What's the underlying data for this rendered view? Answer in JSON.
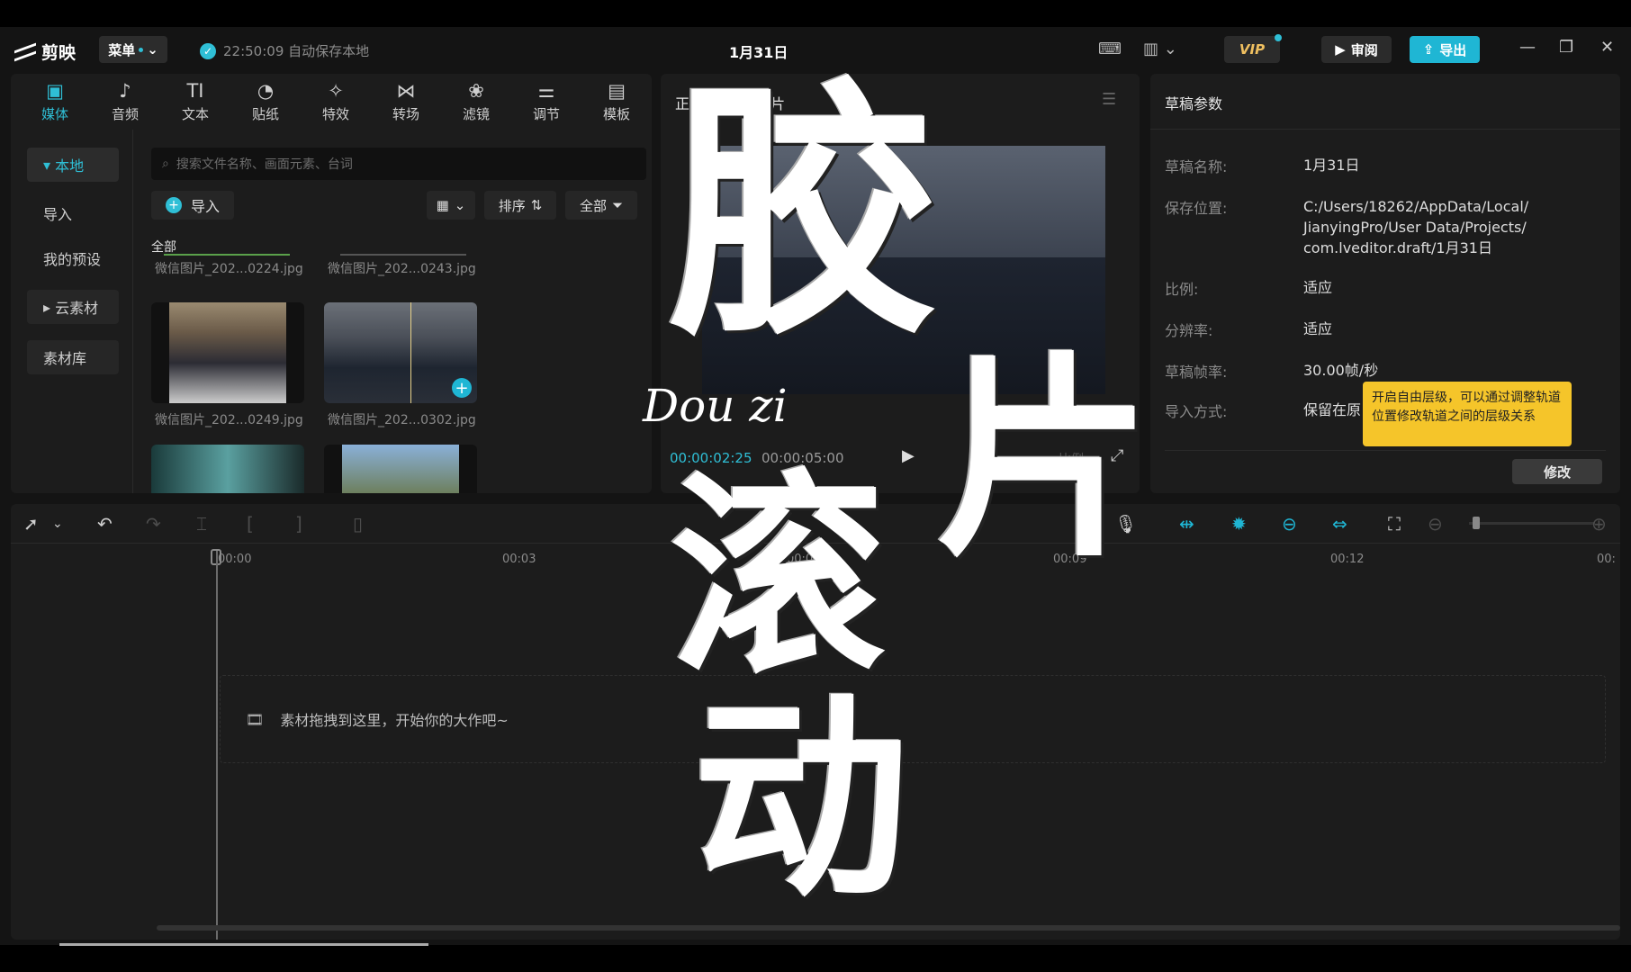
{
  "app": {
    "name": "剪映",
    "title": "1月31日",
    "menu_label": "菜单",
    "save_status": "22:50:09 自动保存本地"
  },
  "header": {
    "vip": "VIP",
    "review": "审阅",
    "export": "导出"
  },
  "tool_tabs": [
    {
      "label": "媒体",
      "icon": "media-icon"
    },
    {
      "label": "音频",
      "icon": "audio-icon"
    },
    {
      "label": "文本",
      "icon": "text-icon"
    },
    {
      "label": "贴纸",
      "icon": "sticker-icon"
    },
    {
      "label": "特效",
      "icon": "effects-icon"
    },
    {
      "label": "转场",
      "icon": "transition-icon"
    },
    {
      "label": "滤镜",
      "icon": "filter-icon"
    },
    {
      "label": "调节",
      "icon": "adjust-icon"
    },
    {
      "label": "模板",
      "icon": "template-icon"
    }
  ],
  "side_nav": [
    "本地",
    "导入",
    "我的预设",
    "云素材",
    "素材库"
  ],
  "media": {
    "search_placeholder": "搜索文件名称、画面元素、台词",
    "import_label": "导入",
    "sort_label": "排序",
    "filter_label": "全部",
    "section_label": "全部",
    "files": [
      "微信图片_202...0224.jpg",
      "微信图片_202...0243.jpg",
      "微信图片_202...0249.jpg",
      "微信图片_202...0302.jpg"
    ]
  },
  "preview": {
    "title": "正在预览 — 图片",
    "time_current": "00:00:02:25",
    "time_total": "00:00:05:00",
    "ratio_label": "比例"
  },
  "params": {
    "header": "草稿参数",
    "rows": [
      {
        "label": "草稿名称:",
        "value": "1月31日"
      },
      {
        "label": "保存位置:",
        "value": "C:/Users/18262/AppData/Local/\nJianyingPro/User Data/Projects/\ncom.lveditor.draft/1月31日"
      },
      {
        "label": "比例:",
        "value": "适应"
      },
      {
        "label": "分辨率:",
        "value": "适应"
      },
      {
        "label": "草稿帧率:",
        "value": "30.00帧/秒"
      },
      {
        "label": "导入方式:",
        "value": "保留在原"
      }
    ],
    "tooltip": "开启自由层级，可以通过调整轨道位置修改轨道之间的层级关系",
    "modify_label": "修改"
  },
  "timeline": {
    "ticks": [
      "00:00",
      "00:03",
      "00:06",
      "00:09",
      "00:12",
      "00:"
    ],
    "drop_hint": "素材拖拽到这里，开始你的大作吧~"
  },
  "overlay": {
    "chars": [
      "胶",
      "片",
      "滚",
      "动"
    ],
    "script": "Dou zi"
  },
  "colors": {
    "accent": "#1fb6d4",
    "tooltip": "#f5c52a",
    "bg": "#141414",
    "panel": "#1c1c1c"
  }
}
